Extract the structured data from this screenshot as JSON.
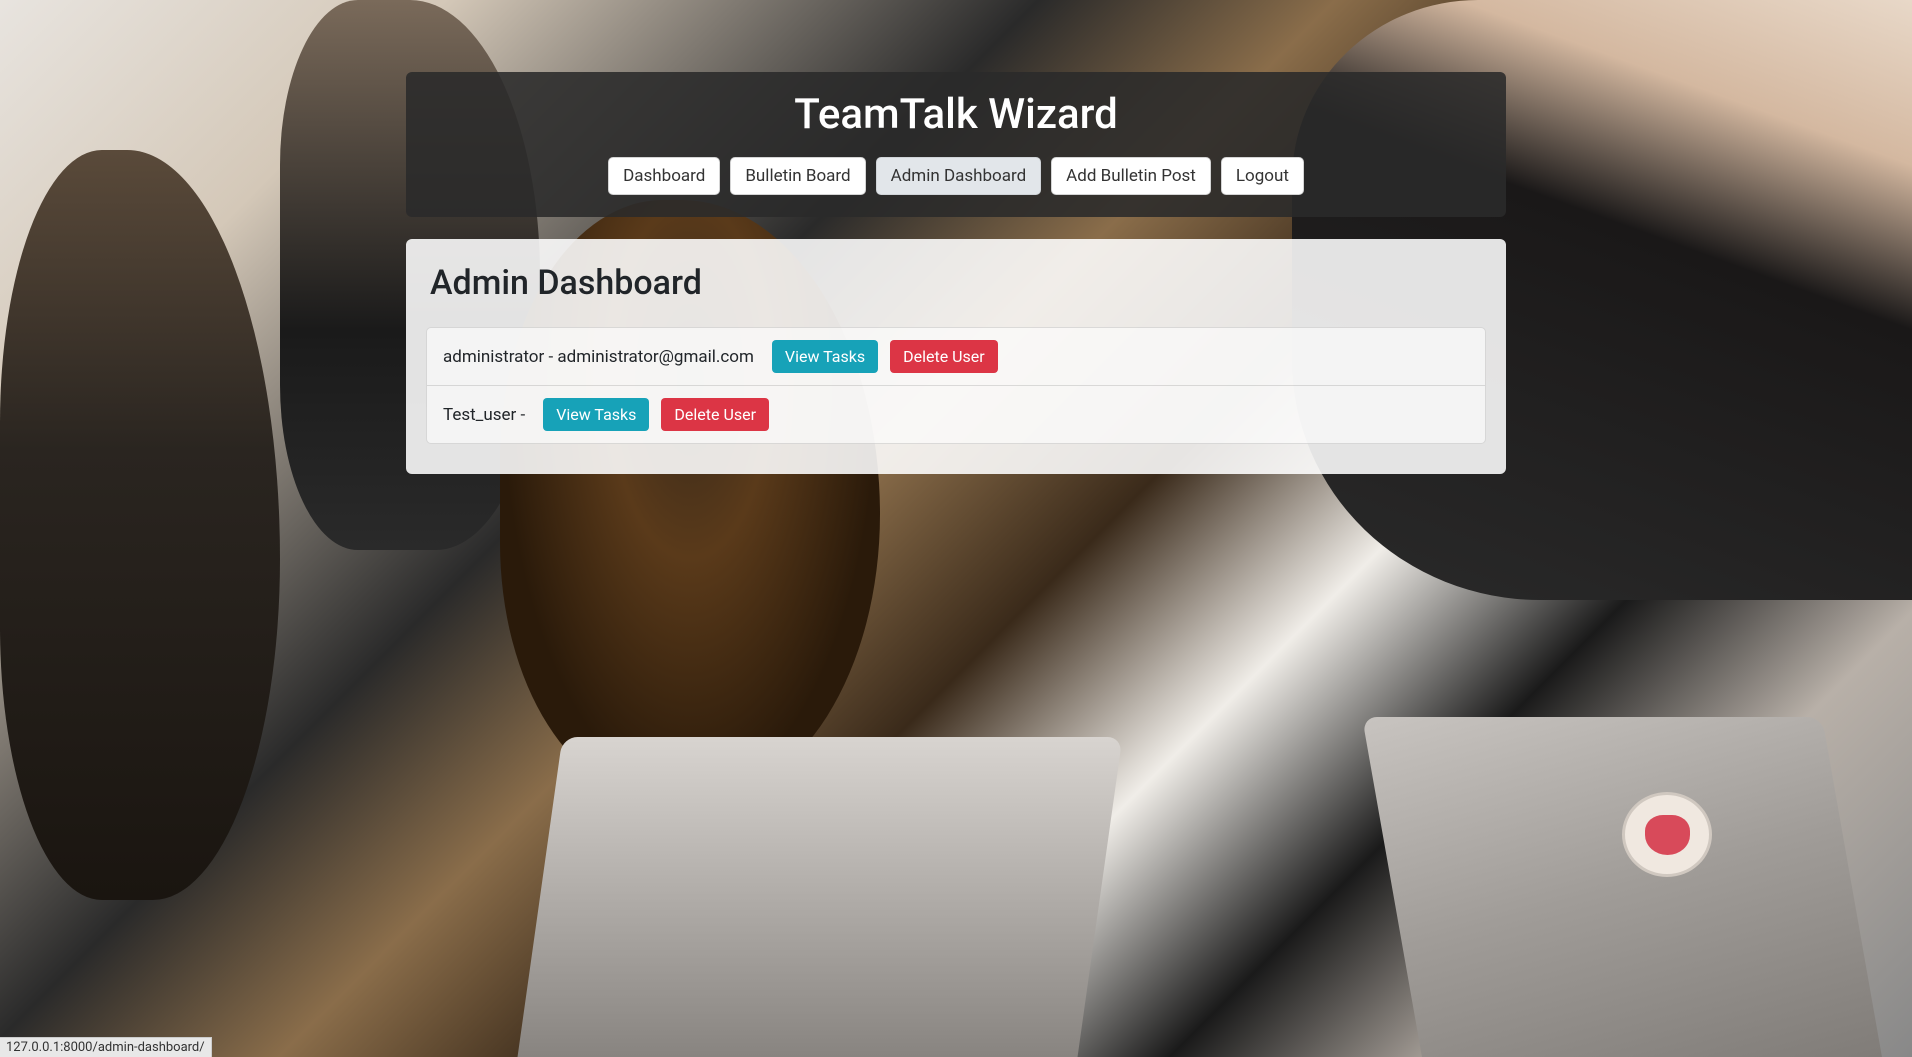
{
  "header": {
    "title": "TeamTalk Wizard",
    "nav": [
      {
        "label": "Dashboard",
        "active": false
      },
      {
        "label": "Bulletin Board",
        "active": false
      },
      {
        "label": "Admin Dashboard",
        "active": true
      },
      {
        "label": "Add Bulletin Post",
        "active": false
      },
      {
        "label": "Logout",
        "active": false
      }
    ]
  },
  "main": {
    "page_title": "Admin Dashboard",
    "users": [
      {
        "username": "administrator",
        "email": "administrator@gmail.com"
      },
      {
        "username": "Test_user",
        "email": ""
      }
    ],
    "buttons": {
      "view_tasks": "View Tasks",
      "delete_user": "Delete User"
    }
  },
  "status_bar": {
    "text": "127.0.0.1:8000/admin-dashboard/"
  }
}
